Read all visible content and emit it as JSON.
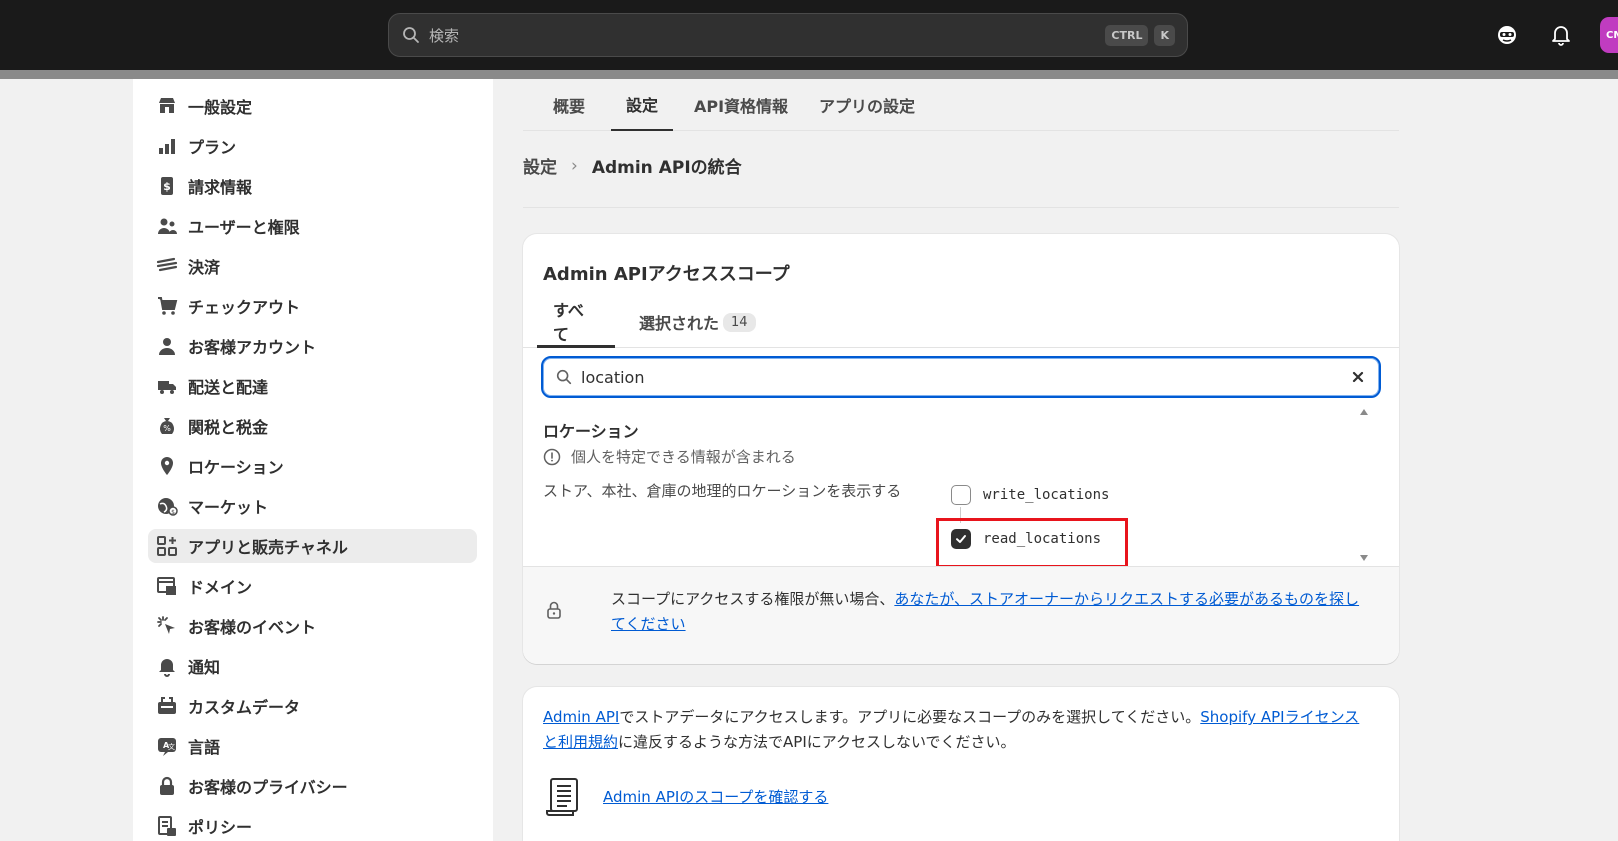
{
  "topbar": {
    "search_placeholder": "検索",
    "kbd_ctrl": "CTRL",
    "kbd_k": "K",
    "avatar_initials": "CM"
  },
  "sidebar": {
    "items": [
      {
        "label": "一般設定",
        "icon": "store-icon"
      },
      {
        "label": "プラン",
        "icon": "plan-icon"
      },
      {
        "label": "請求情報",
        "icon": "billing-icon"
      },
      {
        "label": "ユーザーと権限",
        "icon": "users-icon"
      },
      {
        "label": "決済",
        "icon": "payments-icon"
      },
      {
        "label": "チェックアウト",
        "icon": "cart-icon"
      },
      {
        "label": "お客様アカウント",
        "icon": "person-icon"
      },
      {
        "label": "配送と配達",
        "icon": "truck-icon"
      },
      {
        "label": "関税と税金",
        "icon": "tax-icon"
      },
      {
        "label": "ロケーション",
        "icon": "location-pin-icon"
      },
      {
        "label": "マーケット",
        "icon": "globe-icon"
      },
      {
        "label": "アプリと販売チャネル",
        "icon": "apps-icon",
        "active": true
      },
      {
        "label": "ドメイン",
        "icon": "domain-icon"
      },
      {
        "label": "お客様のイベント",
        "icon": "cursor-click-icon"
      },
      {
        "label": "通知",
        "icon": "bell-icon"
      },
      {
        "label": "カスタムデータ",
        "icon": "metafields-icon"
      },
      {
        "label": "言語",
        "icon": "language-icon"
      },
      {
        "label": "お客様のプライバシー",
        "icon": "lock-icon"
      },
      {
        "label": "ポリシー",
        "icon": "policy-icon"
      }
    ]
  },
  "tabs": [
    "概要",
    "設定",
    "API資格情報",
    "アプリの設定"
  ],
  "active_tab": "設定",
  "breadcrumb": {
    "parent": "設定",
    "separator": "›",
    "current": "Admin APIの統合"
  },
  "scope_card": {
    "title": "Admin APIアクセススコープ",
    "tab_all": "すべて",
    "tab_selected": "選択された",
    "selected_count": "14",
    "filter_value": "location",
    "section_title": "ロケーション",
    "pii_note": "個人を特定できる情報が含まれる",
    "description": "ストア、本社、倉庫の地理的ロケーションを表示する",
    "scopes": [
      {
        "name": "write_locations",
        "checked": false
      },
      {
        "name": "read_locations",
        "checked": true
      }
    ],
    "notice_text": "スコープにアクセスする権限が無い場合、",
    "notice_link": "あなたが、ストアオーナーからリクエストする必要があるものを探してください"
  },
  "info_card": {
    "link_admin_api": "Admin API",
    "text1": "でストアデータにアクセスします。アプリに必要なスコープのみを選択してください。",
    "link_license": "Shopify APIライセンスと利用規約",
    "text2": "に違反するような方法でAPIにアクセスしないでください。",
    "link_scopes": "Admin APIのスコープを確認する"
  },
  "colors": {
    "accent": "#005bd3",
    "highlight": "#e8141c",
    "topbar": "#1a1a1a"
  }
}
